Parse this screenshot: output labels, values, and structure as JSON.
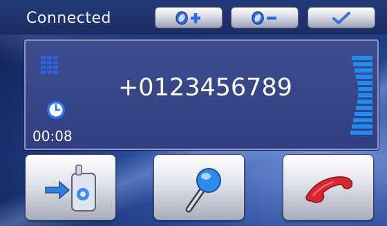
{
  "status": {
    "text": "Connected"
  },
  "toolbar": {
    "buttons": [
      {
        "name": "volume-up",
        "icon": "volume-plus-icon"
      },
      {
        "name": "volume-down",
        "icon": "volume-minus-icon"
      },
      {
        "name": "confirm",
        "icon": "checkmark-icon"
      }
    ]
  },
  "call": {
    "number": "+0123456789",
    "duration": "00:08",
    "keypad_icon": "keypad-icon",
    "clock_icon": "clock-icon",
    "signal_icon": "signal-level-icon"
  },
  "actions": [
    {
      "name": "transfer-to-phone",
      "icon": "phone-transfer-icon"
    },
    {
      "name": "microphone",
      "icon": "microphone-icon"
    },
    {
      "name": "hang-up",
      "icon": "hang-up-icon"
    }
  ],
  "colors": {
    "accent_blue": "#2a6be0",
    "hangup_red": "#d8262f",
    "mic_blue": "#2b8be8"
  }
}
